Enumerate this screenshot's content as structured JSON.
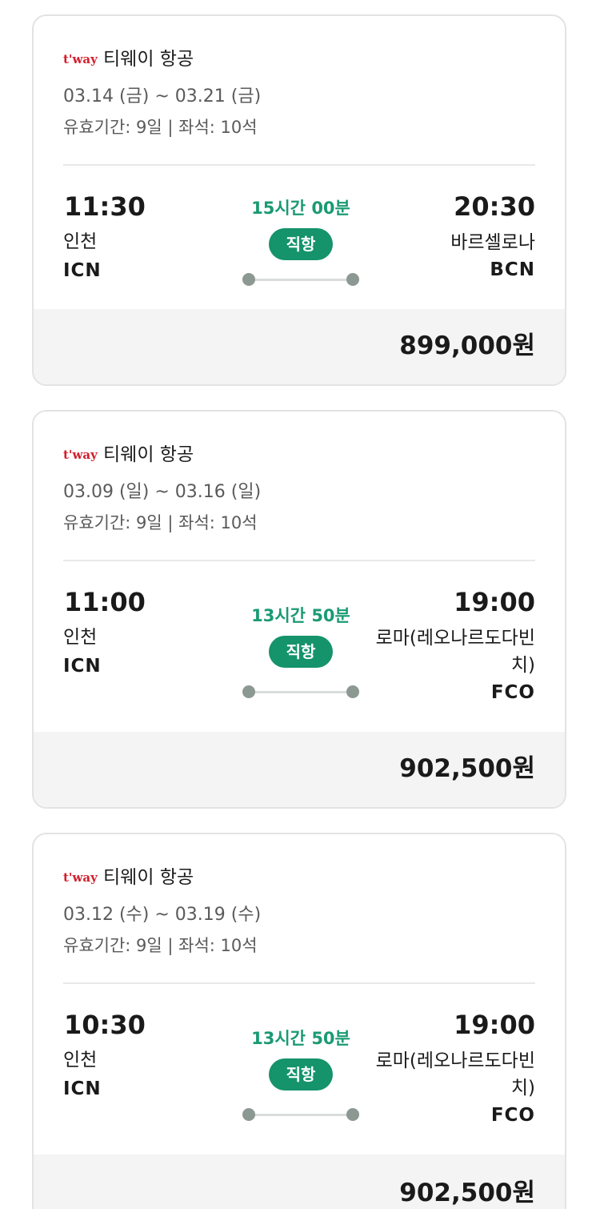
{
  "flights": [
    {
      "logo": "t'way",
      "airline": "티웨이 항공",
      "dates": "03.14 (금) ~ 03.21 (금)",
      "validity": "유효기간: 9일 | 좌석: 10석",
      "dep_time": "11:30",
      "dep_city": "인천",
      "dep_code": "ICN",
      "duration": "15시간 00분",
      "badge": "직항",
      "arr_time": "20:30",
      "arr_city": "바르셀로나",
      "arr_code": "BCN",
      "price": "899,000원"
    },
    {
      "logo": "t'way",
      "airline": "티웨이 항공",
      "dates": "03.09 (일) ~ 03.16 (일)",
      "validity": "유효기간: 9일 | 좌석: 10석",
      "dep_time": "11:00",
      "dep_city": "인천",
      "dep_code": "ICN",
      "duration": "13시간 50분",
      "badge": "직항",
      "arr_time": "19:00",
      "arr_city": "로마(레오나르도다빈치)",
      "arr_code": "FCO",
      "price": "902,500원"
    },
    {
      "logo": "t'way",
      "airline": "티웨이 항공",
      "dates": "03.12 (수) ~ 03.19 (수)",
      "validity": "유효기간: 9일 | 좌석: 10석",
      "dep_time": "10:30",
      "dep_city": "인천",
      "dep_code": "ICN",
      "duration": "13시간 50분",
      "badge": "직항",
      "arr_time": "19:00",
      "arr_city": "로마(레오나르도다빈치)",
      "arr_code": "FCO",
      "price": "902,500원"
    }
  ],
  "colors": {
    "accent_green": "#15936b",
    "duration_green": "#1a9a73",
    "logo_red": "#d21e2b"
  }
}
